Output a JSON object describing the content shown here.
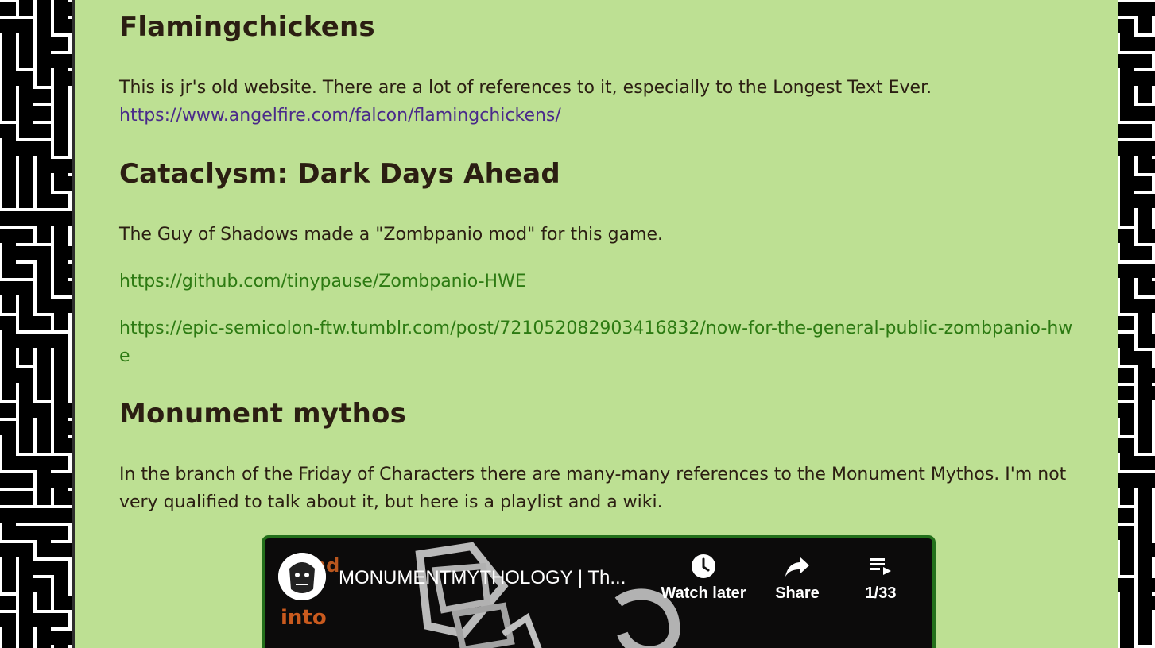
{
  "sections": {
    "flamingchickens": {
      "title": "Flamingchickens",
      "text": "This is jr's old website. There are a lot of references to it, especially to the Longest Text Ever.",
      "link": "https://www.angelfire.com/falcon/flamingchickens/"
    },
    "cataclysm": {
      "title": "Cataclysm: Dark Days Ahead",
      "text": "The Guy of Shadows made a \"Zombpanio mod\" for this game.",
      "link1": "https://github.com/tinypause/Zombpanio-HWE",
      "link2": "https://epic-semicolon-ftw.tumblr.com/post/721052082903416832/now-for-the-general-public-zombpanio-hwe"
    },
    "monument": {
      "title": "Monument mythos",
      "text": "In the branch of the Friday of Characters there are many-many references to the Monument Mythos. I'm not very qualified to talk about it, but here is a playlist and a wiki."
    }
  },
  "video": {
    "title": "MONUMENTMYTHOLOGY | Th...",
    "watch_later": "Watch later",
    "share": "Share",
    "playlist_count": "1/33",
    "thumb_text_1": "nd",
    "thumb_text_2": "into"
  },
  "colors": {
    "background": "#bde093",
    "text": "#2b1e12",
    "visited_link": "#4a2a8a",
    "link": "#2c7a12",
    "video_border": "#23701b"
  }
}
